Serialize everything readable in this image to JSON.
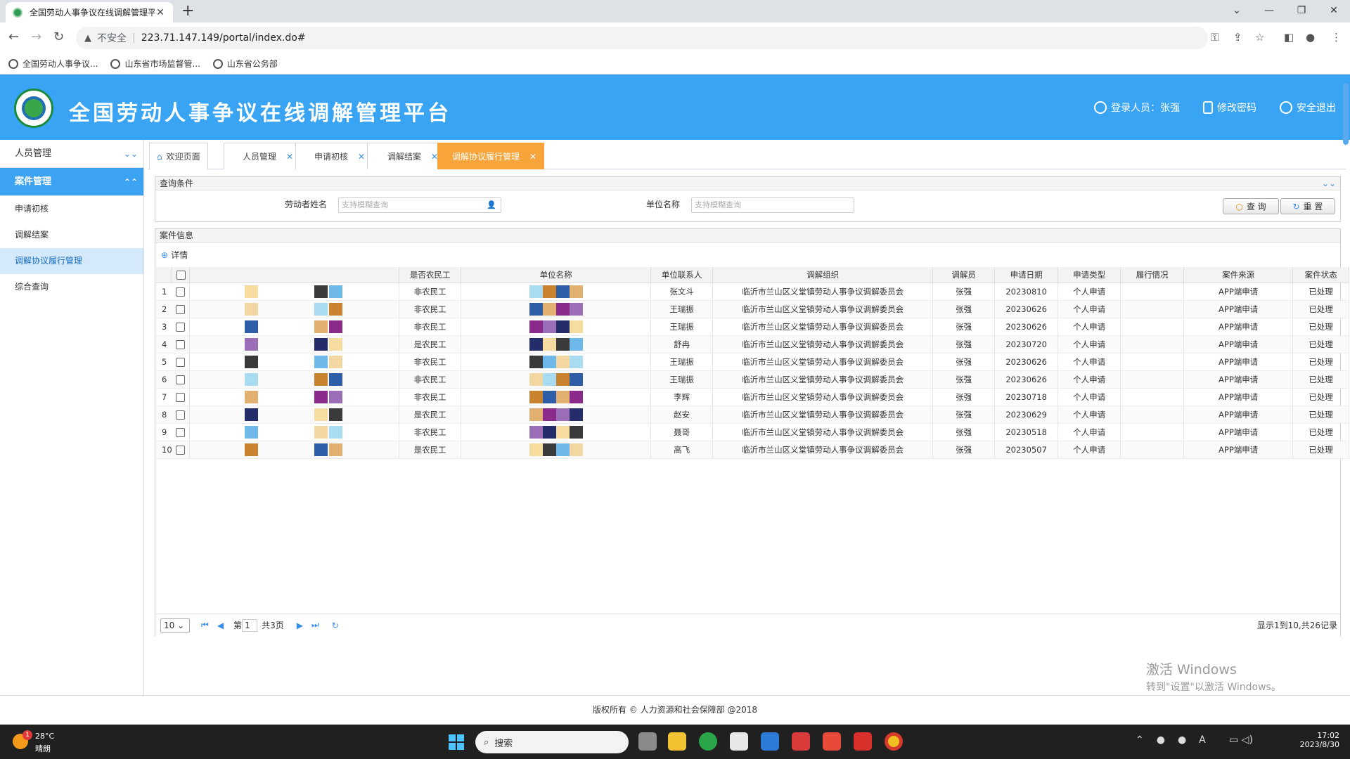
{
  "browser": {
    "tab_title": "全国劳动人事争议在线调解管理平台",
    "url_warning": "不安全",
    "url": "223.71.147.149/portal/index.do#",
    "bookmarks": [
      "全国劳动人事争议...",
      "山东省市场监督管...",
      "山东省公务部"
    ]
  },
  "app": {
    "title": "全国劳动人事争议在线调解管理平台",
    "user_label": "登录人员：张强",
    "change_pwd": "修改密码",
    "logout": "安全退出"
  },
  "sidebar": {
    "groups": [
      {
        "label": "人员管理"
      },
      {
        "label": "案件管理"
      }
    ],
    "items": [
      "申请初核",
      "调解结案",
      "调解协议履行管理",
      "综合查询"
    ]
  },
  "tabs": [
    "欢迎页面",
    "人员管理",
    "申请初核",
    "调解结案",
    "调解协议履行管理"
  ],
  "query": {
    "title": "查询条件",
    "worker_label": "劳动者姓名",
    "worker_placeholder": "支持模糊查询",
    "unit_label": "单位名称",
    "unit_placeholder": "支持模糊查询",
    "search_btn": "查 询",
    "reset_btn": "重 置"
  },
  "cases": {
    "title": "案件信息",
    "detail_btn": "详情",
    "columns": [
      "是否农民工",
      "单位名称",
      "单位联系人",
      "调解组织",
      "调解员",
      "申请日期",
      "申请类型",
      "履行情况",
      "案件来源",
      "案件状态"
    ],
    "rows": [
      {
        "n": "1",
        "migrant": "非农民工",
        "contact": "张文斗",
        "org": "临沂市兰山区义堂镇劳动人事争议调解委员会",
        "mediator": "张强",
        "date": "20230810",
        "type": "个人申请",
        "perf": "",
        "source": "APP端申请",
        "status": "已处理"
      },
      {
        "n": "2",
        "migrant": "非农民工",
        "contact": "王瑞振",
        "org": "临沂市兰山区义堂镇劳动人事争议调解委员会",
        "mediator": "张强",
        "date": "20230626",
        "type": "个人申请",
        "perf": "",
        "source": "APP端申请",
        "status": "已处理"
      },
      {
        "n": "3",
        "migrant": "非农民工",
        "contact": "王瑞振",
        "org": "临沂市兰山区义堂镇劳动人事争议调解委员会",
        "mediator": "张强",
        "date": "20230626",
        "type": "个人申请",
        "perf": "",
        "source": "APP端申请",
        "status": "已处理"
      },
      {
        "n": "4",
        "migrant": "是农民工",
        "contact": "舒冉",
        "org": "临沂市兰山区义堂镇劳动人事争议调解委员会",
        "mediator": "张强",
        "date": "20230720",
        "type": "个人申请",
        "perf": "",
        "source": "APP端申请",
        "status": "已处理"
      },
      {
        "n": "5",
        "migrant": "非农民工",
        "contact": "王瑞振",
        "org": "临沂市兰山区义堂镇劳动人事争议调解委员会",
        "mediator": "张强",
        "date": "20230626",
        "type": "个人申请",
        "perf": "",
        "source": "APP端申请",
        "status": "已处理"
      },
      {
        "n": "6",
        "migrant": "非农民工",
        "contact": "王瑞振",
        "org": "临沂市兰山区义堂镇劳动人事争议调解委员会",
        "mediator": "张强",
        "date": "20230626",
        "type": "个人申请",
        "perf": "",
        "source": "APP端申请",
        "status": "已处理"
      },
      {
        "n": "7",
        "migrant": "非农民工",
        "contact": "李辉",
        "org": "临沂市兰山区义堂镇劳动人事争议调解委员会",
        "mediator": "张强",
        "date": "20230718",
        "type": "个人申请",
        "perf": "",
        "source": "APP端申请",
        "status": "已处理"
      },
      {
        "n": "8",
        "migrant": "是农民工",
        "contact": "赵安",
        "org": "临沂市兰山区义堂镇劳动人事争议调解委员会",
        "mediator": "张强",
        "date": "20230629",
        "type": "个人申请",
        "perf": "",
        "source": "APP端申请",
        "status": "已处理"
      },
      {
        "n": "9",
        "migrant": "非农民工",
        "contact": "聂哥",
        "org": "临沂市兰山区义堂镇劳动人事争议调解委员会",
        "mediator": "张强",
        "date": "20230518",
        "type": "个人申请",
        "perf": "",
        "source": "APP端申请",
        "status": "已处理"
      },
      {
        "n": "10",
        "migrant": "是农民工",
        "contact": "高飞",
        "org": "临沂市兰山区义堂镇劳动人事争议调解委员会",
        "mediator": "张强",
        "date": "20230507",
        "type": "个人申请",
        "perf": "",
        "source": "APP端申请",
        "status": "已处理"
      }
    ]
  },
  "pager": {
    "page_size": "10",
    "page_prefix": "第",
    "page": "1",
    "total_pages": "共3页",
    "summary": "显示1到10,共26记录"
  },
  "footer": "版权所有 © 人力资源和社会保障部 @2018",
  "watermark": {
    "line1": "激活 Windows",
    "line2": "转到\"设置\"以激活 Windows。"
  },
  "taskbar": {
    "temp": "28°C",
    "weather": "晴朗",
    "badge": "1",
    "search": "搜索",
    "time": "17:02",
    "date": "2023/8/30"
  }
}
